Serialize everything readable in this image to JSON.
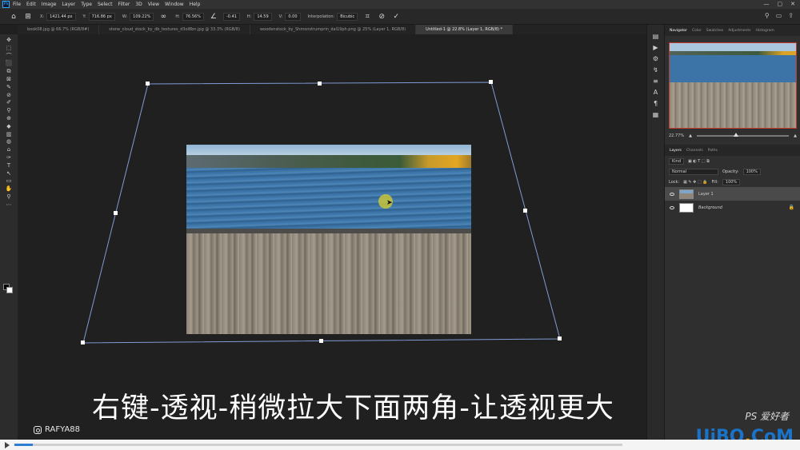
{
  "app": {
    "logo": "Ps"
  },
  "menu": [
    "File",
    "Edit",
    "Image",
    "Layer",
    "Type",
    "Select",
    "Filter",
    "3D",
    "View",
    "Window",
    "Help"
  ],
  "window_controls": [
    "—",
    "▢",
    "✕"
  ],
  "options_bar": {
    "x_label": "X:",
    "x_value": "1421.44 px",
    "y_label": "Y:",
    "y_value": "716.86 px",
    "w_label": "W:",
    "w_value": "109.22%",
    "h_label": "H:",
    "h_value": "76.56%",
    "angle_value": "-0.41",
    "h_skew_label": "H:",
    "h_skew_value": "14.59",
    "v_skew_label": "V:",
    "v_skew_value": "0.00",
    "interpolation_label": "Interpolation:",
    "interpolation_value": "Bicubic",
    "cancel_icon": "cancel-icon",
    "commit_icon": "check-icon"
  },
  "tabs": [
    {
      "label": "book08.jpg @ 66.7% (RGB/8#)",
      "active": false
    },
    {
      "label": "stone_cloud_stock_by_db_textures_d3ol8bn.jpg @ 33.3% (RGB/8)",
      "active": false
    },
    {
      "label": "woodenstock_by_Shmonstrumprin_dal19ph.png @ 25% (Layer 1, RGB/8)",
      "active": false
    },
    {
      "label": "Untitled-1 @ 22.8% (Layer 1, RGB/8) *",
      "active": true
    }
  ],
  "tools": [
    "✥",
    "⬚",
    "⌒",
    "⬛",
    "⧉",
    "⊠",
    "✎",
    "⊘",
    "✐",
    "⚲",
    "⊕",
    "◆",
    "▥",
    "◍",
    "⌂",
    "✑",
    "T",
    "↖",
    "▭",
    "✋",
    "⚲",
    "⋯"
  ],
  "subtitle": "右键-透视-稍微拉大下面两角-让透视更大",
  "watermark_user": "RAFYA88",
  "site_logo_main": "UiBQ",
  "site_logo_dot": ".",
  "site_logo_tail": "CoM",
  "ps_mark": "PS 爱好者",
  "right_strip_icons": [
    "▤",
    "▶",
    "⚙",
    "↯",
    "≡",
    "A",
    "¶",
    "▦"
  ],
  "navigator": {
    "tabs": [
      "Navigator",
      "Color",
      "Swatches",
      "Adjustments",
      "Histogram"
    ],
    "zoom": "22.77%",
    "zoom_level": 0.4
  },
  "layers": {
    "tabs": [
      "Layers",
      "Channels",
      "Paths"
    ],
    "kind_label": "Kind",
    "blend_mode": "Normal",
    "opacity_label": "Opacity:",
    "opacity_value": "100%",
    "lock_label": "Lock:",
    "fill_label": "Fill:",
    "fill_value": "100%",
    "items": [
      {
        "name": "Layer 1",
        "selected": true
      },
      {
        "name": "Background",
        "selected": false,
        "locked": true
      }
    ]
  },
  "video": {
    "progress": 0.03
  }
}
